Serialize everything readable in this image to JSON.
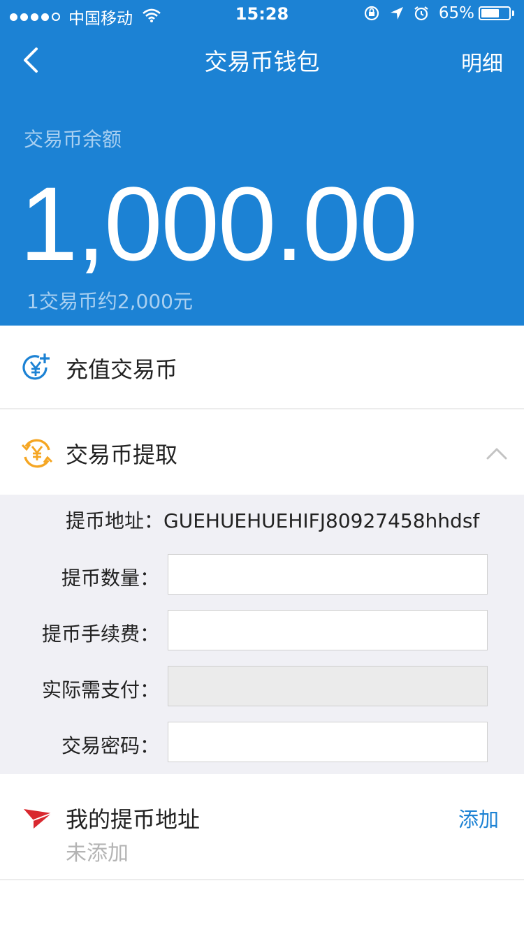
{
  "status_bar": {
    "signal_dots": [
      true,
      true,
      true,
      true,
      false
    ],
    "carrier": "中国移动",
    "time": "15:28",
    "battery_percent_label": "65%",
    "battery_level": 0.65
  },
  "nav": {
    "title": "交易币钱包",
    "detail_label": "明细"
  },
  "wallet": {
    "balance_label": "交易币余额",
    "balance": "1,000.00",
    "rate": "1交易币约2,000元"
  },
  "recharge": {
    "label": "充值交易币",
    "icon": "yen-plus-icon",
    "icon_color": "#1c82d4"
  },
  "withdraw": {
    "label": "交易币提取",
    "icon": "yen-exchange-icon",
    "icon_color": "#f5a623",
    "expanded": true,
    "address_label": "提币地址：GUEHUEHUEHIFJ80927458hhdsf",
    "fields": [
      {
        "label": "提币数量：",
        "value": "",
        "disabled": false
      },
      {
        "label": "提币手续费：",
        "value": "",
        "disabled": false
      },
      {
        "label": "实际需支付：",
        "value": "",
        "disabled": true
      },
      {
        "label": "交易密码：",
        "value": "",
        "disabled": false
      }
    ]
  },
  "my_address": {
    "title": "我的提币地址",
    "subtitle": "未添加",
    "action_label": "添加",
    "icon": "paper-plane-icon",
    "icon_color": "#d9282f"
  },
  "colors": {
    "primary": "#1c82d4",
    "panel_bg": "#f0f0f5"
  }
}
